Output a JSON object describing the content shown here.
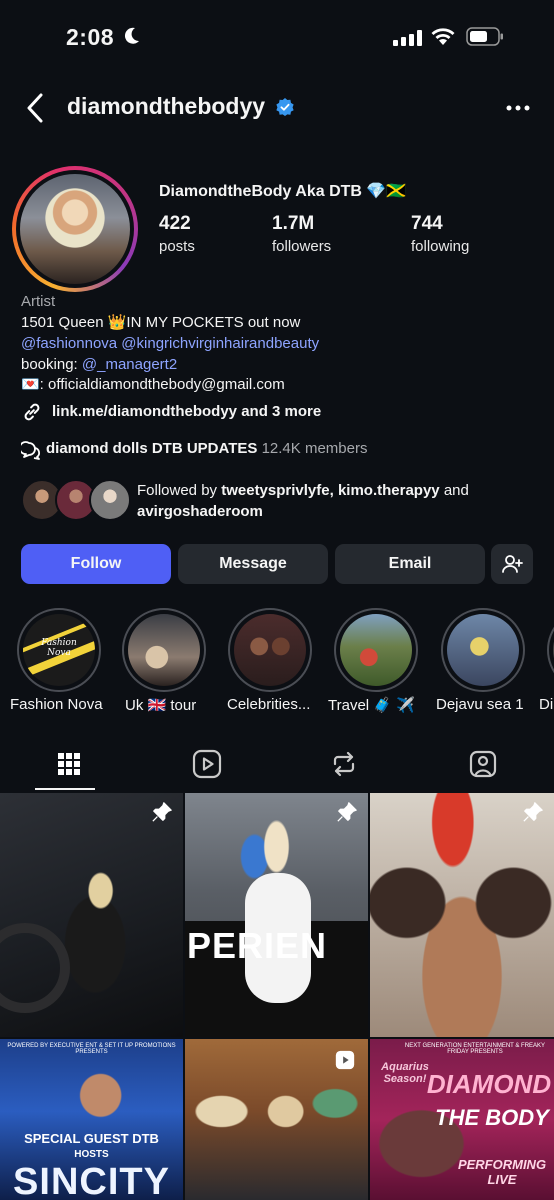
{
  "status_bar": {
    "time": "2:08"
  },
  "header": {
    "username": "diamondthebodyy"
  },
  "profile": {
    "display_name": "DiamondtheBody Aka DTB 💎🇯🇲",
    "stats": [
      {
        "value": "422",
        "label": "posts"
      },
      {
        "value": "1.7M",
        "label": "followers"
      },
      {
        "value": "744",
        "label": "following"
      }
    ],
    "category": "Artist",
    "bio_line1": "1501 Queen 👑IN MY POCKETS out now",
    "bio_mentions": "@fashionnova @kingrichvirginhairandbeauty",
    "booking_label": "booking: ",
    "booking_handle": "@_managert2",
    "email_line": "💌: officialdiamondthebody@gmail.com",
    "link_text": "link.me/diamondthebodyy and 3 more",
    "community_name": "diamond dolls DTB UPDATES",
    "community_members": "12.4K members",
    "followed_by_prefix": "Followed by ",
    "followed_by_names": "tweetysprivlyfe, kimo.therapyy",
    "followed_by_and": " and",
    "followed_by_last": "avirgoshaderoom"
  },
  "buttons": {
    "follow": "Follow",
    "message": "Message",
    "email": "Email"
  },
  "highlights": [
    {
      "label": "Fashion Nova",
      "cover_text": "Fashion Nova"
    },
    {
      "label": "Uk 🇬🇧 tour"
    },
    {
      "label": "Celebrities..."
    },
    {
      "label": "Travel 🧳 ✈️"
    },
    {
      "label": "Dejavu sea 1"
    },
    {
      "label": "Di"
    }
  ],
  "grid_posts": [
    {
      "pinned": true
    },
    {
      "pinned": true,
      "overlay_text": "PERIEN"
    },
    {
      "pinned": true
    },
    {
      "top_text": "POWERED BY EXECUTIVE ENT & SET IT UP PROMOTIONS PRESENTS",
      "guest_text": "SPECIAL GUEST DTB",
      "hosts_text": "HOSTS",
      "big_text": "SINCITY"
    },
    {
      "reel": true
    },
    {
      "top_text": "NEXT GENERATION ENTERTAINMENT & FREAKY FRIDAY PRESENTS",
      "side_text": "Aquarius Season!",
      "big_text_1": "DIAMOND",
      "big_text_2": "THE BODY",
      "sub_text": "PERFORMING LIVE"
    }
  ]
}
